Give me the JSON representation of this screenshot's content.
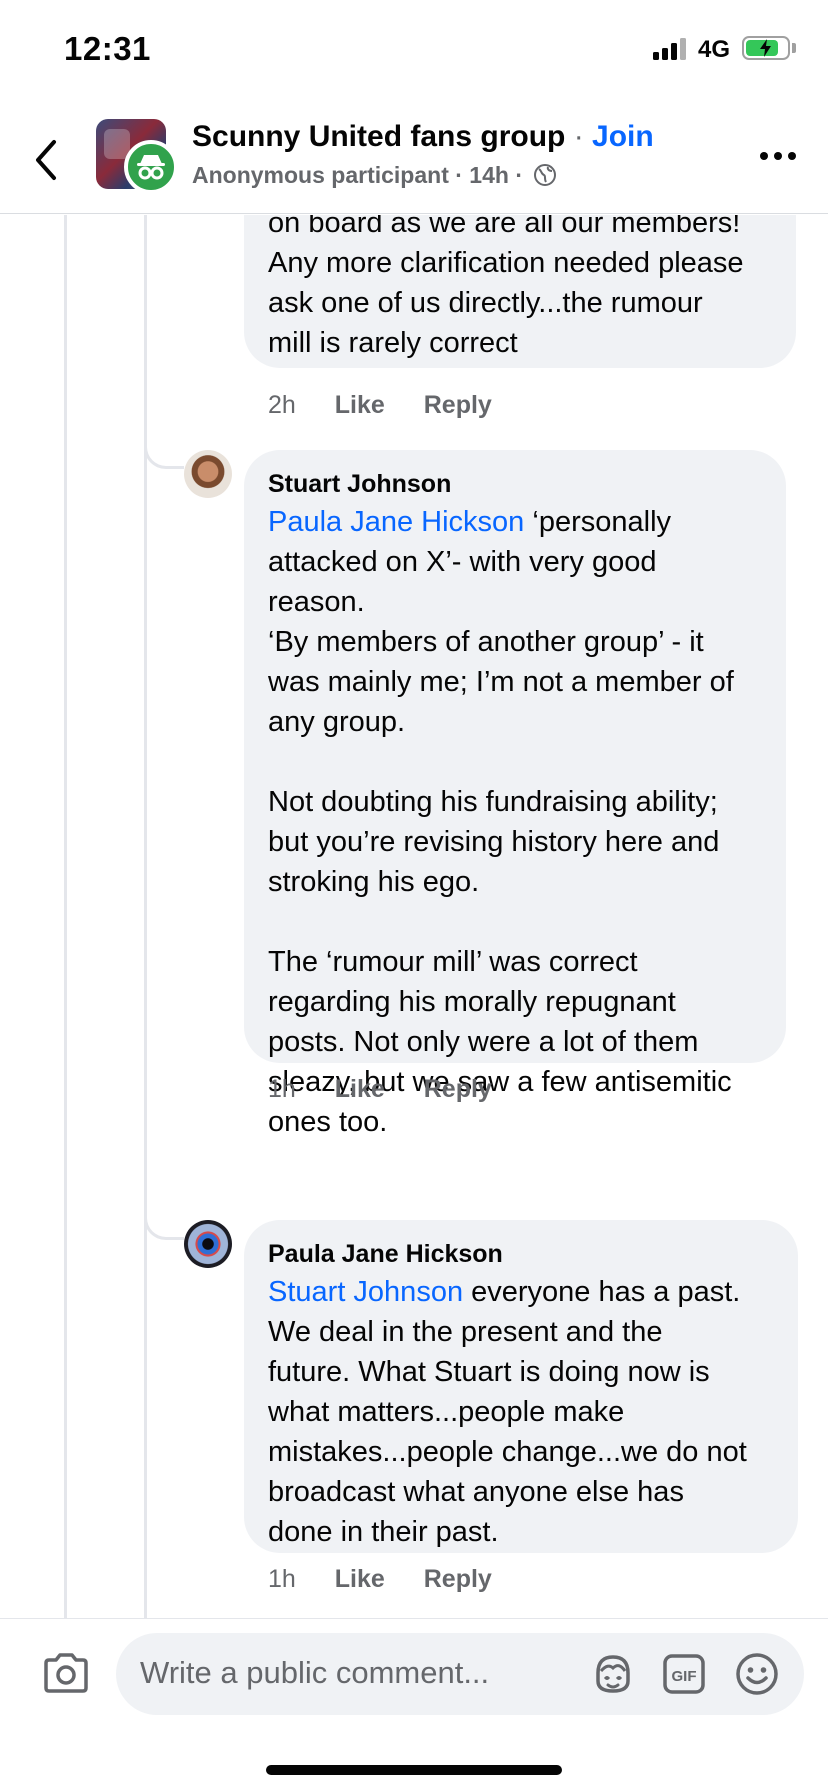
{
  "status_bar": {
    "time": "12:31",
    "network": "4G",
    "battery_level": 0.8
  },
  "header": {
    "group_name": "Scunny United fans group",
    "separator": "·",
    "join_label": "Join",
    "subtitle": "Anonymous participant · 14h ·"
  },
  "comments": [
    {
      "text": "on board as we are all our members!\nAny more clarification needed please\nask one of us directly...the rumour\nmill is rarely correct",
      "time": "2h",
      "like_label": "Like",
      "reply_label": "Reply"
    },
    {
      "author": "Stuart Johnson",
      "mention": "Paula Jane Hickson",
      "text": " ‘personally\nattacked on X’- with very good\nreason.\n‘By members of another group’ - it\nwas mainly me; I’m not a member of\nany group.\n\nNot doubting his fundraising ability;\nbut you’re revising history here and\nstroking his ego.\n\nThe ‘rumour mill’ was correct\nregarding his morally repugnant\nposts. Not only were a lot of them\nsleazy, but we saw a few antisemitic\nones too.",
      "time": "1h",
      "like_label": "Like",
      "reply_label": "Reply"
    },
    {
      "author": "Paula Jane Hickson",
      "mention": "Stuart Johnson",
      "text": " everyone has a past.\nWe deal in the present and the\nfuture. What Stuart is doing now is\nwhat matters...people make\nmistakes...people change...we do not\nbroadcast what anyone else has\ndone in their past.",
      "time": "1h",
      "like_label": "Like",
      "reply_label": "Reply"
    }
  ],
  "composer": {
    "placeholder": "Write a public comment...",
    "icons": [
      "camera-icon",
      "avatar-sticker-icon",
      "gif-icon",
      "emoji-icon"
    ],
    "gif_label": "GIF"
  },
  "colors": {
    "link": "#0866ff",
    "bubble": "#f0f2f5",
    "secondary_text": "#65676b",
    "anonymous_badge": "#31a24c"
  }
}
